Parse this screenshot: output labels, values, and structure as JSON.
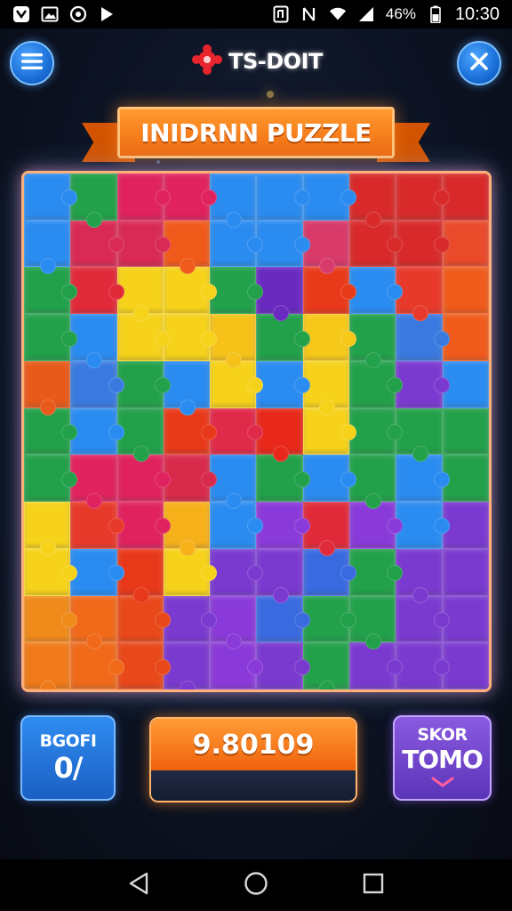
{
  "status_bar": {
    "battery": "46%",
    "time": "10:30",
    "icons": [
      "app-notification-icon",
      "gallery-icon",
      "sync-icon",
      "play-icon",
      "nfc-icon",
      "mute-icon",
      "wifi-icon",
      "signal-icon",
      "battery-icon"
    ]
  },
  "header": {
    "menu_icon": "hamburger-menu-icon",
    "close_icon": "close-icon",
    "brand": "TS-DOIT",
    "title": "INIDRNN PUZZLE"
  },
  "board": {
    "columns": 10,
    "rows": 11,
    "pieces": [
      "#2a8bf0",
      "#22a04a",
      "#e0225e",
      "#e0225e",
      "#2a8bf0",
      "#2a8bf0",
      "#2a8bf0",
      "#d82a2a",
      "#d82a2a",
      "#d82a2a",
      "#2a8bf0",
      "#d82a55",
      "#d82a55",
      "#f05a1a",
      "#2a8bf0",
      "#2a8bf0",
      "#d83a6a",
      "#d82a2a",
      "#d82a2a",
      "#e84a2a",
      "#22a04a",
      "#e02a3a",
      "#f6d21a",
      "#f6d21a",
      "#22a04a",
      "#6a2ac0",
      "#e83a1a",
      "#2a8bf0",
      "#e83a2a",
      "#f05a1a",
      "#22a04a",
      "#2a8bf0",
      "#f6d21a",
      "#f6d21a",
      "#f6c21a",
      "#22a04a",
      "#f6c81a",
      "#22a04a",
      "#3a7ae0",
      "#f05a1a",
      "#e85a1a",
      "#3a7ae0",
      "#22a04a",
      "#2a8bf0",
      "#f6d21a",
      "#2a8bf0",
      "#f6d21a",
      "#22a04a",
      "#7a3ad0",
      "#2a8bf0",
      "#22a04a",
      "#2a8bf0",
      "#22a04a",
      "#e83a1a",
      "#e02a4a",
      "#e8281a",
      "#f6d21a",
      "#22a04a",
      "#22a04a",
      "#22a04a",
      "#22a04a",
      "#e0225e",
      "#e0225e",
      "#d82a4a",
      "#2a8bf0",
      "#22a04a",
      "#2a8bf0",
      "#22a04a",
      "#2a8bf0",
      "#22a04a",
      "#f6d21a",
      "#e83a2a",
      "#e0225e",
      "#f6b01a",
      "#2a8bf0",
      "#8a3ad8",
      "#e02a3a",
      "#8a3ad8",
      "#2a8bf0",
      "#7a3ad0",
      "#f6d21a",
      "#2a8bf0",
      "#e8381a",
      "#f6d21a",
      "#7a3ad0",
      "#7a3ad0",
      "#3a6ae0",
      "#22a04a",
      "#7a3ad0",
      "#7a3ad0",
      "#f08a1a",
      "#f06a1a",
      "#e8481a",
      "#7a3ad0",
      "#8a3ad8",
      "#3a6ae0",
      "#22a04a",
      "#22a04a",
      "#7a3ad0",
      "#7a3ad0",
      "#f07a1a",
      "#f06a1a",
      "#e8481a",
      "#7a3ad0",
      "#8a3ad8",
      "#7a3ad0",
      "#22a04a",
      "#7a3ad0",
      "#7a3ad0",
      "#7a3ad0"
    ]
  },
  "stats": {
    "left_label": "BGOFI",
    "left_value": "0/",
    "score": "9.80109",
    "right_label": "SKOR",
    "right_value": "TOMO"
  },
  "nav": {
    "back_icon": "back-icon",
    "home_icon": "home-icon",
    "recents_icon": "recents-icon"
  },
  "colors": {
    "accent_orange": "#f06a10",
    "accent_blue": "#1a6fd8",
    "accent_purple": "#5b34b8",
    "background": "#0d1424"
  }
}
